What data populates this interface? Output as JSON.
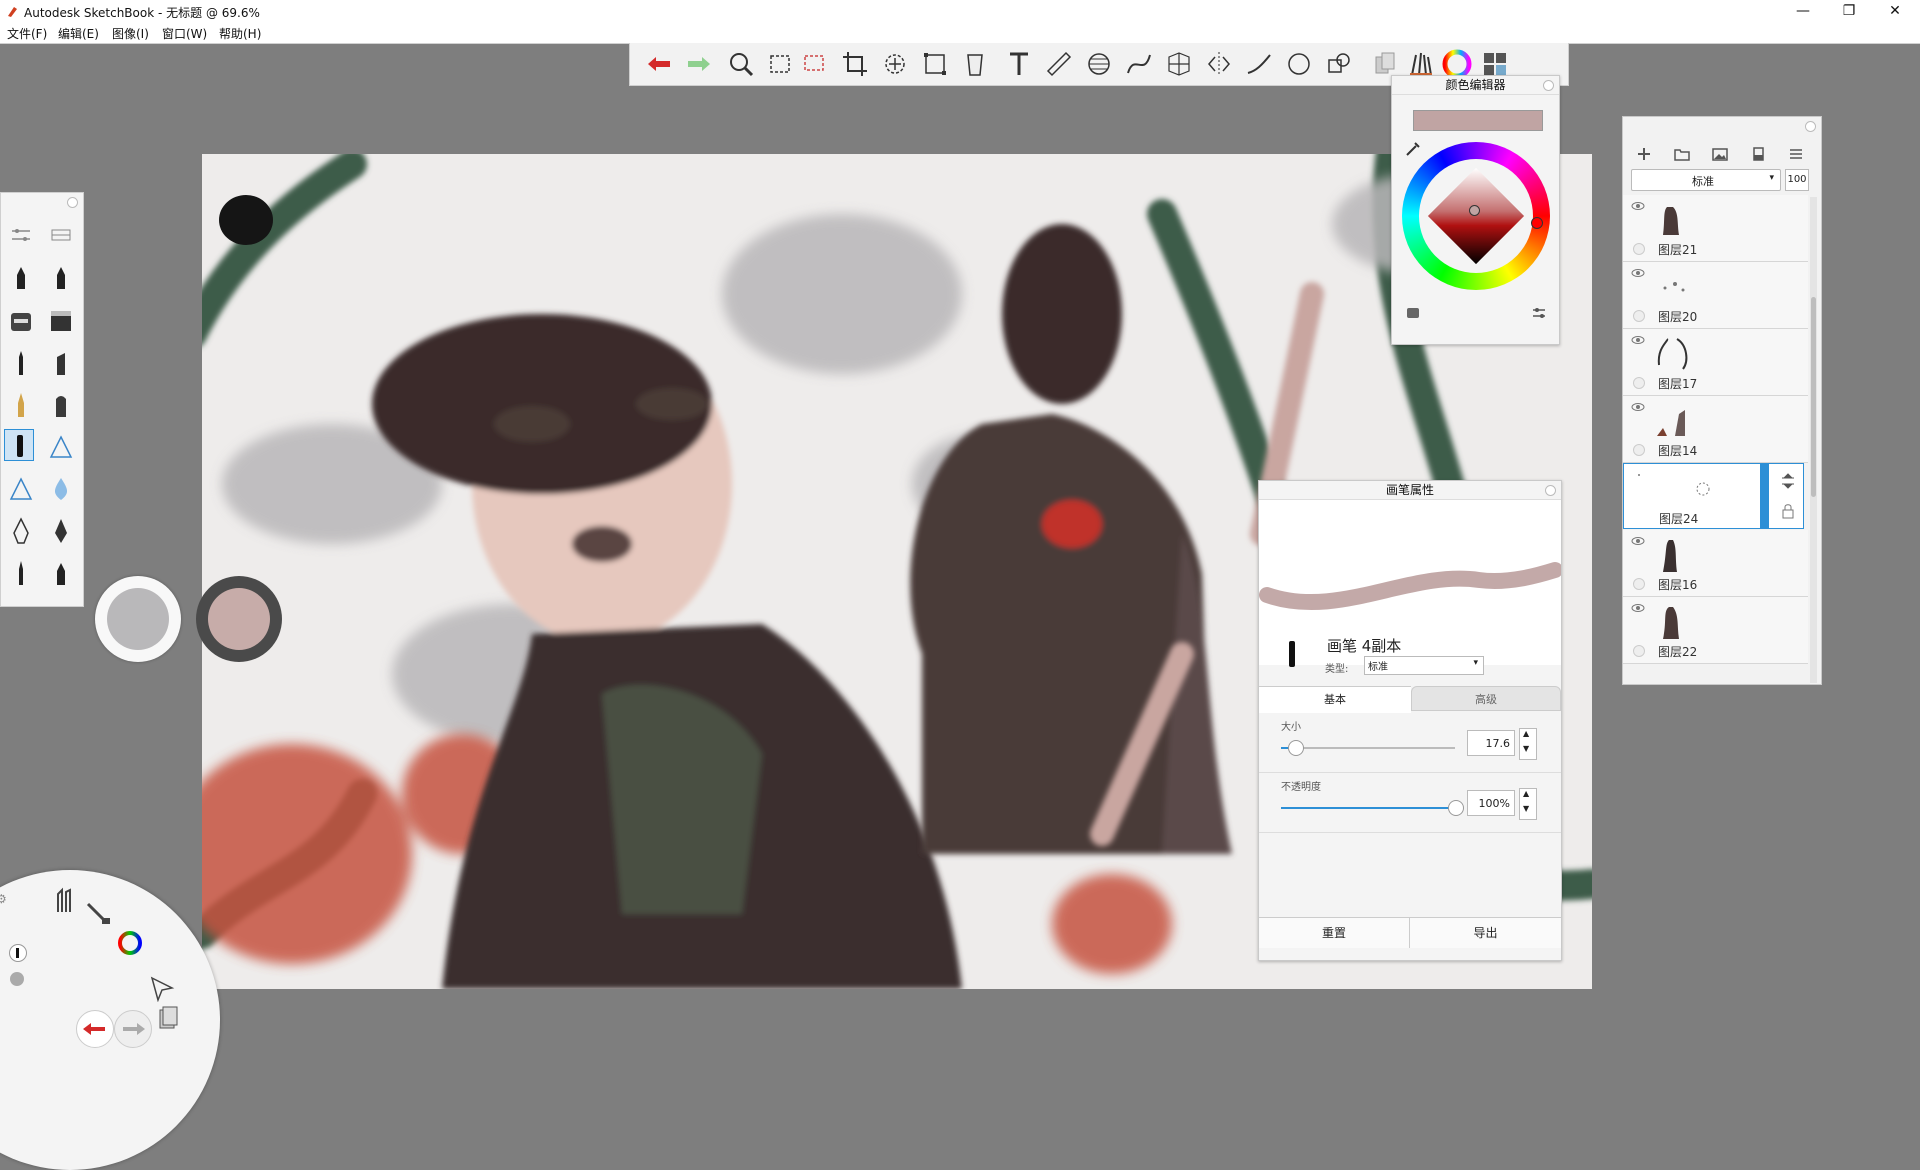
{
  "window": {
    "title": "Autodesk SketchBook - 无标题 @ 69.6%",
    "minimize": "—",
    "restore": "❐",
    "close": "✕"
  },
  "menu": [
    "文件(F)",
    "编辑(E)",
    "图像(I)",
    "窗口(W)",
    "帮助(H)"
  ],
  "toolbar": {
    "tools": [
      "undo-icon",
      "redo-icon",
      "zoom-icon",
      "rect-select-icon",
      "lasso-select-icon",
      "crop-icon",
      "transform-icon",
      "distort-icon",
      "fill-icon",
      "text-icon",
      "ruler-icon",
      "ellipse-icon",
      "french-curve-icon",
      "perspective-icon",
      "symmetry-icon",
      "line-icon",
      "circle-icon",
      "shape-icon",
      "copic-icon",
      "brush-library-icon",
      "color-wheel-icon",
      "layer-editor-icon"
    ]
  },
  "color_editor": {
    "title": "颜色编辑器",
    "current_color": "#c0a4a3"
  },
  "layers": {
    "blend_mode": "标准",
    "opacity": "100",
    "items": [
      {
        "name": "图层21"
      },
      {
        "name": "图层20"
      },
      {
        "name": "图层17"
      },
      {
        "name": "图层14"
      },
      {
        "name": "图层24",
        "selected": true
      },
      {
        "name": "图层16"
      },
      {
        "name": "图层22"
      }
    ]
  },
  "brush_properties": {
    "title": "画笔属性",
    "brush_name": "画笔  4副本",
    "type_label": "类型:",
    "type_value": "标准",
    "tabs": [
      "基本",
      "高级"
    ],
    "size_label": "大小",
    "size_value": "17.6",
    "size_fraction": 0.08,
    "opacity_label": "不透明度",
    "opacity_value": "100%",
    "opacity_fraction": 1.0,
    "reset_button": "重置",
    "export_button": "导出"
  },
  "colors": {
    "primary": "#c0a4a3",
    "secondary": "#b9b8ba",
    "accent": "#2d8fd6"
  }
}
